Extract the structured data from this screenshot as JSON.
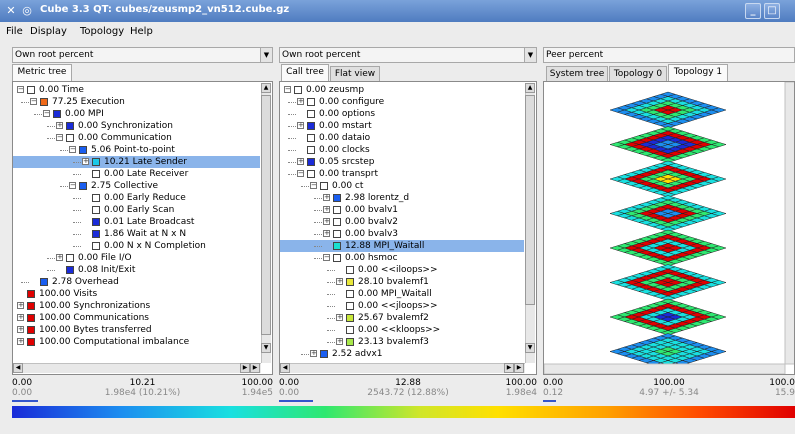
{
  "window": {
    "title": "Cube 3.3 QT: cubes/zeusmp2_vn512.cube.gz",
    "sys_icon": "✕",
    "app_icon": "◎",
    "minimize": "_",
    "maximize": "□"
  },
  "menu": [
    "File",
    "Display",
    "Topology",
    "Help"
  ],
  "metric_pane": {
    "combo": "Own root percent",
    "tabs": [
      "Metric tree"
    ],
    "rows": [
      {
        "value": "0.00",
        "label": "Time",
        "color": "#ffffff"
      },
      {
        "value": "77.25",
        "label": "Execution",
        "color": "#f06a1a"
      },
      {
        "value": "0.00",
        "label": "MPI",
        "color": "#1a2bd8"
      },
      {
        "value": "0.00",
        "label": "Synchronization",
        "color": "#1a2bd8"
      },
      {
        "value": "0.00",
        "label": "Communication",
        "color": "#ffffff"
      },
      {
        "value": "5.06",
        "label": "Point-to-point",
        "color": "#1a5ef0"
      },
      {
        "value": "10.21",
        "label": "Late Sender",
        "color": "#19c8e8"
      },
      {
        "value": "0.00",
        "label": "Late Receiver",
        "color": "#ffffff"
      },
      {
        "value": "2.75",
        "label": "Collective",
        "color": "#1a5ef0"
      },
      {
        "value": "0.00",
        "label": "Early Reduce",
        "color": "#ffffff"
      },
      {
        "value": "0.00",
        "label": "Early Scan",
        "color": "#ffffff"
      },
      {
        "value": "0.01",
        "label": "Late Broadcast",
        "color": "#1a2bd8"
      },
      {
        "value": "1.86",
        "label": "Wait at N x N",
        "color": "#1a2bd8"
      },
      {
        "value": "0.00",
        "label": "N x N Completion",
        "color": "#ffffff"
      },
      {
        "value": "0.00",
        "label": "File I/O",
        "color": "#ffffff"
      },
      {
        "value": "0.08",
        "label": "Init/Exit",
        "color": "#1a2bd8"
      },
      {
        "value": "2.78",
        "label": "Overhead",
        "color": "#1a5ef0"
      },
      {
        "value": "100.00",
        "label": "Visits",
        "color": "#e00000"
      },
      {
        "value": "100.00",
        "label": "Synchronizations",
        "color": "#e00000"
      },
      {
        "value": "100.00",
        "label": "Communications",
        "color": "#e00000"
      },
      {
        "value": "100.00",
        "label": "Bytes transferred",
        "color": "#e00000"
      },
      {
        "value": "100.00",
        "label": "Computational imbalance",
        "color": "#e00000"
      }
    ],
    "status": {
      "min": "0.00",
      "min2": "0.00",
      "value": "10.21",
      "detail": "1.98e4 (10.21%)",
      "max": "100.00",
      "max2": "1.94e5",
      "fill": 0.1
    }
  },
  "call_pane": {
    "combo": "Own root percent",
    "tabs": [
      "Call tree",
      "Flat view"
    ],
    "rows": [
      {
        "value": "0.00",
        "label": "zeusmp",
        "color": "#ffffff"
      },
      {
        "value": "0.00",
        "label": "configure",
        "color": "#ffffff"
      },
      {
        "value": "0.00",
        "label": "options",
        "color": "#ffffff"
      },
      {
        "value": "0.00",
        "label": "mstart",
        "color": "#1a2bd8"
      },
      {
        "value": "0.00",
        "label": "dataio",
        "color": "#ffffff"
      },
      {
        "value": "0.00",
        "label": "clocks",
        "color": "#ffffff"
      },
      {
        "value": "0.05",
        "label": "srcstep",
        "color": "#1a2bd8"
      },
      {
        "value": "0.00",
        "label": "transprt",
        "color": "#ffffff"
      },
      {
        "value": "0.00",
        "label": "ct",
        "color": "#ffffff"
      },
      {
        "value": "2.98",
        "label": "lorentz_d",
        "color": "#1a5ef0"
      },
      {
        "value": "0.00",
        "label": "bvalv1",
        "color": "#ffffff"
      },
      {
        "value": "0.00",
        "label": "bvalv2",
        "color": "#ffffff"
      },
      {
        "value": "0.00",
        "label": "bvalv3",
        "color": "#ffffff"
      },
      {
        "value": "12.88",
        "label": "MPI_Waitall",
        "color": "#19e0d0"
      },
      {
        "value": "0.00",
        "label": "hsmoc",
        "color": "#ffffff"
      },
      {
        "value": "0.00",
        "label": "<<iloops>>",
        "color": "#ffffff"
      },
      {
        "value": "28.10",
        "label": "bvalemf1",
        "color": "#e8e83a"
      },
      {
        "value": "",
        "label": "0.00 MPI_Waitall",
        "color": "#ffffff"
      },
      {
        "value": "0.00",
        "label": "<<jloops>>",
        "color": "#ffffff"
      },
      {
        "value": "25.67",
        "label": "bvalemf2",
        "color": "#c8e83a"
      },
      {
        "value": "0.00",
        "label": "<<kloops>>",
        "color": "#ffffff"
      },
      {
        "value": "23.13",
        "label": "bvalemf3",
        "color": "#a8e84a"
      },
      {
        "value": "2.52",
        "label": "advx1",
        "color": "#1a5ef0"
      }
    ],
    "status": {
      "min": "0.00",
      "min2": "0.00",
      "value": "12.88",
      "detail": "2543.72 (12.88%)",
      "max": "100.00",
      "max2": "1.98e4",
      "fill": 0.13
    }
  },
  "system_pane": {
    "combo": "Peer percent",
    "tabs": [
      "System tree",
      "Topology 0",
      "Topology 1"
    ],
    "status": {
      "min": "0.00",
      "min2": "0.12",
      "value": "100.00",
      "detail": "4.97 +/- 5.34",
      "max": "100.0",
      "max2": "15.9",
      "fill": 0.05
    }
  },
  "colors": {
    "selection": "#8ab4ea",
    "colormap": [
      "#1a2bd8",
      "#1c8ef0",
      "#19e0e0",
      "#2ee870",
      "#cfe62a",
      "#ffe000",
      "#ffa000",
      "#ff4a00",
      "#e00000"
    ]
  },
  "topology": {
    "planes": 8,
    "grid": 8,
    "plane_patterns": [
      [
        [
          1,
          1,
          1,
          1,
          1,
          1,
          1,
          1
        ],
        [
          1,
          2,
          2,
          2,
          2,
          2,
          2,
          1
        ],
        [
          1,
          2,
          3,
          3,
          3,
          3,
          2,
          1
        ],
        [
          1,
          2,
          3,
          8,
          8,
          3,
          2,
          1
        ],
        [
          1,
          2,
          3,
          8,
          8,
          3,
          2,
          1
        ],
        [
          1,
          2,
          3,
          3,
          3,
          3,
          2,
          1
        ],
        [
          1,
          2,
          2,
          2,
          2,
          2,
          2,
          1
        ],
        [
          1,
          1,
          1,
          1,
          1,
          1,
          1,
          1
        ]
      ],
      [
        [
          3,
          3,
          3,
          3,
          3,
          3,
          3,
          3
        ],
        [
          3,
          8,
          8,
          8,
          8,
          8,
          8,
          3
        ],
        [
          3,
          8,
          0,
          0,
          0,
          0,
          8,
          3
        ],
        [
          3,
          8,
          0,
          1,
          1,
          0,
          8,
          3
        ],
        [
          3,
          8,
          0,
          1,
          1,
          0,
          8,
          3
        ],
        [
          3,
          8,
          0,
          0,
          0,
          0,
          8,
          3
        ],
        [
          3,
          8,
          8,
          8,
          8,
          8,
          8,
          3
        ],
        [
          3,
          3,
          3,
          3,
          3,
          3,
          3,
          3
        ]
      ],
      [
        [
          2,
          2,
          2,
          2,
          2,
          2,
          2,
          2
        ],
        [
          2,
          8,
          8,
          8,
          8,
          8,
          8,
          2
        ],
        [
          2,
          8,
          3,
          3,
          3,
          3,
          8,
          2
        ],
        [
          2,
          8,
          3,
          6,
          6,
          3,
          8,
          2
        ],
        [
          2,
          8,
          3,
          6,
          6,
          3,
          8,
          2
        ],
        [
          2,
          8,
          3,
          3,
          3,
          3,
          8,
          2
        ],
        [
          2,
          8,
          8,
          8,
          8,
          8,
          8,
          2
        ],
        [
          2,
          2,
          2,
          2,
          2,
          2,
          2,
          2
        ]
      ],
      [
        [
          2,
          2,
          2,
          2,
          2,
          2,
          2,
          2
        ],
        [
          2,
          3,
          3,
          3,
          3,
          3,
          3,
          2
        ],
        [
          2,
          3,
          8,
          8,
          8,
          8,
          3,
          2
        ],
        [
          2,
          3,
          8,
          1,
          1,
          8,
          3,
          2
        ],
        [
          2,
          3,
          8,
          1,
          1,
          8,
          3,
          2
        ],
        [
          2,
          3,
          8,
          8,
          8,
          8,
          3,
          2
        ],
        [
          2,
          3,
          3,
          3,
          3,
          3,
          3,
          2
        ],
        [
          2,
          2,
          2,
          2,
          2,
          2,
          2,
          2
        ]
      ],
      [
        [
          3,
          3,
          3,
          3,
          3,
          3,
          3,
          3
        ],
        [
          3,
          8,
          8,
          8,
          8,
          8,
          8,
          3
        ],
        [
          3,
          8,
          2,
          2,
          2,
          2,
          8,
          3
        ],
        [
          3,
          8,
          2,
          8,
          8,
          2,
          8,
          3
        ],
        [
          3,
          8,
          2,
          8,
          8,
          2,
          8,
          3
        ],
        [
          3,
          8,
          2,
          2,
          2,
          2,
          8,
          3
        ],
        [
          3,
          8,
          8,
          8,
          8,
          8,
          8,
          3
        ],
        [
          3,
          3,
          3,
          3,
          3,
          3,
          3,
          3
        ]
      ],
      [
        [
          2,
          2,
          2,
          2,
          2,
          2,
          2,
          2
        ],
        [
          2,
          8,
          8,
          8,
          8,
          8,
          8,
          2
        ],
        [
          2,
          8,
          3,
          3,
          3,
          3,
          8,
          2
        ],
        [
          2,
          8,
          3,
          8,
          8,
          3,
          8,
          2
        ],
        [
          2,
          8,
          3,
          8,
          8,
          3,
          8,
          2
        ],
        [
          2,
          8,
          3,
          3,
          3,
          3,
          8,
          2
        ],
        [
          2,
          8,
          8,
          8,
          8,
          8,
          8,
          2
        ],
        [
          2,
          2,
          2,
          2,
          2,
          2,
          2,
          2
        ]
      ],
      [
        [
          3,
          3,
          3,
          3,
          3,
          3,
          3,
          3
        ],
        [
          3,
          8,
          8,
          8,
          8,
          8,
          8,
          3
        ],
        [
          3,
          8,
          2,
          2,
          2,
          2,
          8,
          3
        ],
        [
          3,
          8,
          2,
          0,
          0,
          2,
          8,
          3
        ],
        [
          3,
          8,
          2,
          0,
          0,
          2,
          8,
          3
        ],
        [
          3,
          8,
          2,
          2,
          2,
          2,
          8,
          3
        ],
        [
          3,
          8,
          8,
          8,
          8,
          8,
          8,
          3
        ],
        [
          3,
          3,
          3,
          3,
          3,
          3,
          3,
          3
        ]
      ],
      [
        [
          1,
          1,
          1,
          1,
          1,
          1,
          1,
          1
        ],
        [
          1,
          2,
          2,
          2,
          2,
          2,
          2,
          1
        ],
        [
          1,
          2,
          2,
          2,
          2,
          2,
          2,
          1
        ],
        [
          1,
          2,
          2,
          3,
          3,
          2,
          2,
          1
        ],
        [
          1,
          2,
          2,
          3,
          3,
          2,
          2,
          1
        ],
        [
          1,
          2,
          2,
          2,
          2,
          2,
          2,
          1
        ],
        [
          1,
          2,
          2,
          2,
          2,
          2,
          2,
          1
        ],
        [
          1,
          1,
          1,
          1,
          1,
          1,
          1,
          1
        ]
      ]
    ]
  }
}
